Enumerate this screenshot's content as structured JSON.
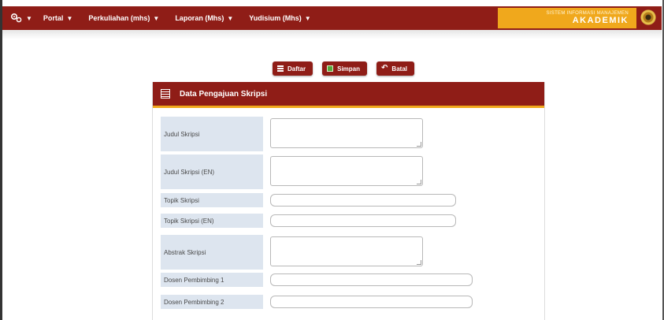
{
  "nav": {
    "items": [
      {
        "label": "Portal"
      },
      {
        "label": "Perkuliahan (mhs)"
      },
      {
        "label": "Laporan (Mhs)"
      },
      {
        "label": "Yudisium (Mhs)"
      }
    ],
    "brand_subtitle": "SISTEM INFORMASI MANAJEMEN",
    "brand_title": "AKADEMIK"
  },
  "actions": {
    "list_label": "Daftar",
    "save_label": "Simpan",
    "reset_label": "Batal"
  },
  "panel": {
    "title": "Data Pengajuan Skripsi",
    "fields": [
      {
        "label": "Judul Skripsi",
        "value": ""
      },
      {
        "label": "Judul Skripsi (EN)",
        "value": ""
      },
      {
        "label": "Topik Skripsi",
        "value": ""
      },
      {
        "label": "Topik Skripsi (EN)",
        "value": ""
      },
      {
        "label": "Abstrak Skripsi",
        "value": ""
      },
      {
        "label": "Dosen Pembimbing 1",
        "value": ""
      },
      {
        "label": "Dosen Pembimbing 2",
        "value": ""
      }
    ]
  },
  "colors": {
    "brand_red": "#8f1d17",
    "brand_gold": "#f0a81c",
    "label_bg": "#dde5ef"
  }
}
